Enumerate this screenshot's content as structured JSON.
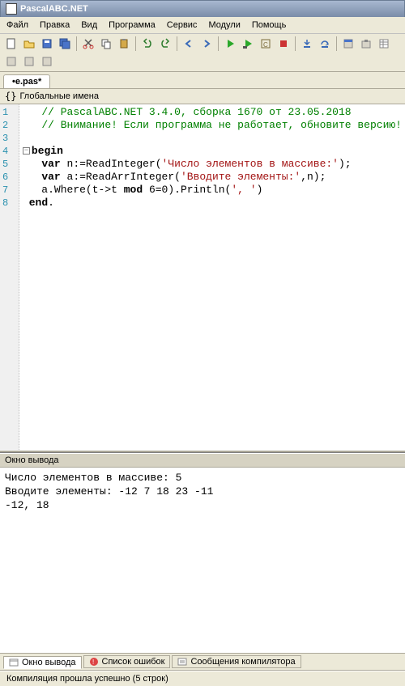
{
  "title": "PascalABC.NET",
  "menu": {
    "file": "Файл",
    "edit": "Правка",
    "view": "Вид",
    "program": "Программа",
    "service": "Сервис",
    "modules": "Модули",
    "help": "Помощь"
  },
  "tab": {
    "label": "•e.pas*"
  },
  "globals": {
    "label": "Глобальные имена"
  },
  "code": {
    "lines": [
      {
        "n": 1,
        "type": "comment",
        "text": "// PascalABC.NET 3.4.0, сборка 1670 от 23.05.2018"
      },
      {
        "n": 2,
        "type": "comment",
        "text": "// Внимание! Если программа не работает, обновите версию!"
      },
      {
        "n": 3,
        "type": "empty",
        "text": ""
      },
      {
        "n": 4,
        "type": "begin",
        "kw": "begin"
      },
      {
        "n": 5,
        "type": "stmt",
        "pre": "   ",
        "kw": "var",
        "mid": " n:=ReadInteger(",
        "str": "'Число элементов в массиве:'",
        "post": ");"
      },
      {
        "n": 6,
        "type": "stmt",
        "pre": "   ",
        "kw": "var",
        "mid": " a:=ReadArrInteger(",
        "str": "'Вводите элементы:'",
        "post": ",n);"
      },
      {
        "n": 7,
        "type": "plain",
        "text": "   a.Where(t->t mod 6=0).Println(', ')",
        "str_inline": "', '"
      },
      {
        "n": 8,
        "type": "end",
        "kw": "end",
        "post": "."
      }
    ]
  },
  "output_panel": {
    "title": "Окно вывода",
    "lines": [
      "Число элементов в массиве: 5",
      "Вводите элементы: -12 7 18 23 -11",
      "-12, 18"
    ]
  },
  "bottom_tabs": {
    "output": "Окно вывода",
    "errors": "Список ошибок",
    "compiler": "Сообщения компилятора"
  },
  "status": "Компиляция прошла успешно (5 строк)",
  "colors": {
    "comment": "#008000",
    "string": "#a31515",
    "gutter_num": "#2b91af"
  }
}
